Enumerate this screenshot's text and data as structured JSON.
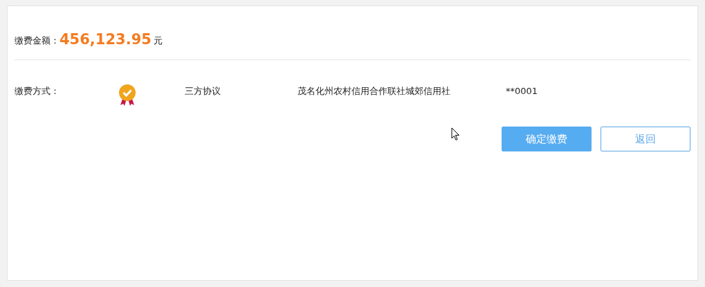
{
  "amount": {
    "label": "缴费金额：",
    "value": "456,123.95",
    "unit": "元"
  },
  "payment_method": {
    "label": "缴费方式：",
    "type": "三方协议",
    "bank": "茂名化州农村信用合作联社城郊信用社",
    "account": "**0001"
  },
  "buttons": [
    {
      "label": "确定缴费",
      "kind": "primary"
    },
    {
      "label": "返回",
      "kind": "outline"
    }
  ]
}
